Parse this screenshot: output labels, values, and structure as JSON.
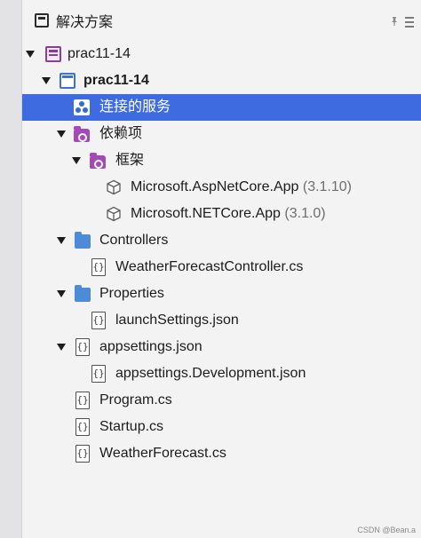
{
  "panel": {
    "title": "解决方案"
  },
  "tree": {
    "solution": "prac11-14",
    "project": "prac11-14",
    "connected_services": "连接的服务",
    "dependencies": "依赖项",
    "frameworks": "框架",
    "framework_items": [
      {
        "name": "Microsoft.AspNetCore.App",
        "version": "(3.1.10)"
      },
      {
        "name": "Microsoft.NETCore.App",
        "version": "(3.1.0)"
      }
    ],
    "controllers_folder": "Controllers",
    "controller_file": "WeatherForecastController.cs",
    "properties_folder": "Properties",
    "launch_settings": "launchSettings.json",
    "appsettings": "appsettings.json",
    "appsettings_dev": "appsettings.Development.json",
    "program": "Program.cs",
    "startup": "Startup.cs",
    "weather_forecast": "WeatherForecast.cs",
    "file_glyph": "{}"
  },
  "watermark": "CSDN @Bean.a",
  "colors": {
    "selected_bg": "#3e6be0",
    "folder": "#4d8ad8",
    "dependency": "#a548b8",
    "solution": "#8b3d9a",
    "project": "#3f6fd0"
  },
  "icons": {
    "panel": "window-icon",
    "pin": "pin-icon",
    "menu": "menu-icon"
  }
}
